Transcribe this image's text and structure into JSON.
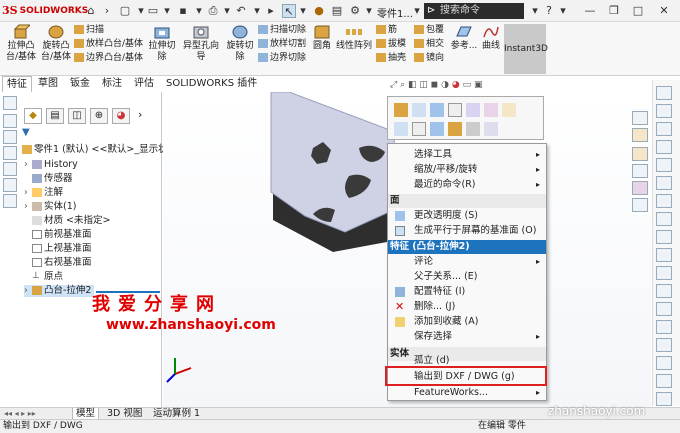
{
  "app": {
    "logo": "SOLIDWORKS",
    "doc_title": "零件1...",
    "search_placeholder": "搜索命令"
  },
  "quick_access": [
    "home-icon",
    "new-icon",
    "open-icon",
    "save-icon",
    "print-icon",
    "undo-icon",
    "select-icon",
    "rebuild-icon",
    "options-icon"
  ],
  "ribbon": {
    "boss_extrude": "拉伸凸台/基体",
    "revolve_boss": "旋转凸台/基体",
    "sweep": "扫描",
    "loft": "放样凸台/基体",
    "boundary_boss": "边界凸台/基体",
    "extrude_cut": "拉伸切除",
    "hole_wizard": "异型孔向导",
    "revolve_cut": "旋转切除",
    "swept_cut": "扫描切除",
    "lofted_cut": "放样切割",
    "boundary_cut": "边界切除",
    "fillet": "圆角",
    "linear_pattern": "线性阵列",
    "rib": "筋",
    "draft": "拔模",
    "shell": "抽壳",
    "wrap": "包覆",
    "intersect": "相交",
    "mirror": "镜向",
    "reference": "参考...",
    "curves": "曲线",
    "instant3d": "Instant3D"
  },
  "tabs": [
    "特征",
    "草图",
    "钣金",
    "标注",
    "评估",
    "SOLIDWORKS 插件"
  ],
  "tree": {
    "part": "零件1 (默认) <<默认>_显示状",
    "items": [
      "History",
      "传感器",
      "注解",
      "实体(1)",
      "材质 <未指定>",
      "前视基准面",
      "上视基准面",
      "右视基准面",
      "原点",
      "凸台-拉伸2"
    ]
  },
  "context_menu": {
    "items_top": [
      "选择工具",
      "缩放/平移/旋转",
      "最近的命令(R)"
    ],
    "header_face": "面",
    "face_items": [
      "更改透明度 (S)",
      "生成平行于屏幕的基准面 (O)"
    ],
    "header_feature": "特征 (凸台-拉伸2)",
    "feature_items": [
      "评论",
      "父子关系... (E)",
      "配置特征 (I)",
      "删除... (J)",
      "添加到收藏 (A)",
      "保存选择"
    ],
    "header_body": "实体",
    "body_items": [
      "孤立 (d)",
      "输出到 DXF / DWG (g)",
      "FeatureWorks..."
    ]
  },
  "bottom_tabs": [
    "模型",
    "3D 视图",
    "运动算例 1"
  ],
  "status": {
    "left": "输出到 DXF / DWG",
    "center": "在编辑 零件"
  },
  "watermark": {
    "line1": "我爱分享网",
    "line2": "www.zhanshaoyi.com",
    "corner": "zhanshaoyi.com"
  },
  "colors": {
    "accent": "#1e73be",
    "highlight": "#e02020",
    "brand": "#c00000"
  }
}
